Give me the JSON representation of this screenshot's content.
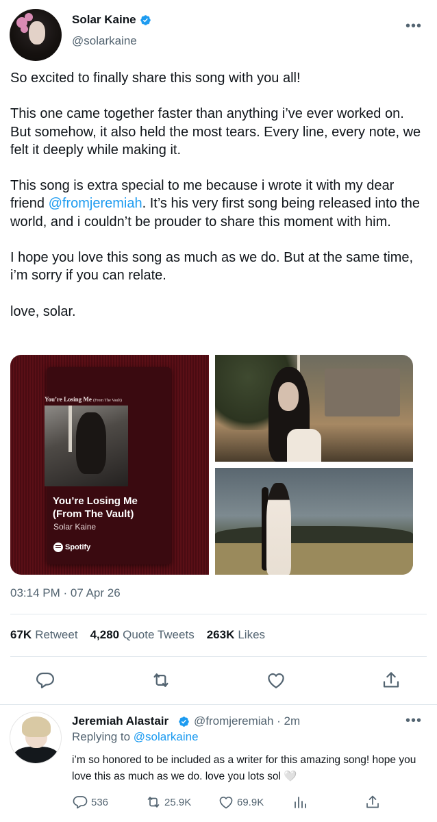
{
  "tweet": {
    "author_name": "Solar Kaine",
    "author_handle": "@solarkaine",
    "paragraphs": {
      "p1": "So excited to finally share this song with you all!",
      "p2": "This one came together faster than anything i’ve ever worked on. But somehow, it also held the most tears. Every line, every note, we felt it deeply while making it.",
      "p3_before": "This song is extra special to me because i wrote it with my dear friend ",
      "p3_mention": "@fromjeremiah",
      "p3_after": ". It’s his very first song being released into the world, and i couldn’t be prouder to share this moment with him.",
      "p4": "I hope you love this song as much as we do. But at the same time, i’m sorry if you can relate.",
      "p5": "love, solar."
    },
    "spotify_card": {
      "small_title": "You’re Losing Me",
      "small_subtitle": "(From The Vault)",
      "song_title": "You’re Losing Me (From The Vault)",
      "artist": "Solar Kaine",
      "brand": "Spotify"
    },
    "timestamp": "03:14 PM · 07 Apr 26",
    "stats": {
      "retweets_num": "67K",
      "retweets_label": "Retweet",
      "quotes_num": "4,280",
      "quotes_label": "Quote Tweets",
      "likes_num": "263K",
      "likes_label": "Likes"
    }
  },
  "reply": {
    "author_name": "Jeremiah Alastair",
    "author_handle": "@fromjeremiah · 2m",
    "replying_prefix": "Replying to",
    "replying_to": "@solarkaine",
    "text": "i’m so honored to be included as a writer for this amazing song! hope you love this as much as we do. love you lots sol 🤍",
    "replies": "536",
    "retweets": "25.9K",
    "likes": "69.9K"
  },
  "colors": {
    "accent": "#1d9bf0",
    "text": "#0f1419",
    "secondary": "#536471",
    "divider": "#e1e8ed"
  },
  "icons": [
    "verified-badge-icon",
    "more-icon",
    "reply-icon",
    "retweet-icon",
    "like-icon",
    "share-icon",
    "views-icon",
    "spotify-logo-icon"
  ]
}
